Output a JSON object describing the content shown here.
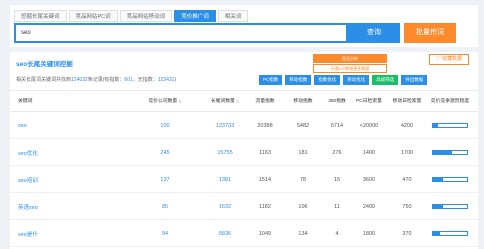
{
  "search": {
    "tabs": [
      "挖掘长尾关键词",
      "竞品网站PC词",
      "竞品网站移动词",
      "竞价推广词",
      "相关词"
    ],
    "active_tab": 3,
    "query": "seo",
    "search_button": "查询",
    "batch_button": "批量挖词"
  },
  "results": {
    "title": "seo长尾关键词挖掘",
    "compare_button": "竞品分析",
    "vip_button": "开通VIP解锁更多数据",
    "favorite_button": "♡ 收藏数据",
    "summary_prefix": "相关长尾词关键词共找到",
    "summary_total": "124032",
    "summary_mid": "条记录(有指数：",
    "summary_indexed": "601",
    "summary_suffix": "无指数：",
    "summary_no_index": "123431",
    "tools": [
      {
        "label": "PC指数",
        "color": "blue"
      },
      {
        "label": "移动指数",
        "color": "blue"
      },
      {
        "label": "指数优化",
        "color": "blue"
      },
      {
        "label": "移动优化",
        "color": "blue"
      },
      {
        "label": "高级筛选",
        "color": "green"
      },
      {
        "label": "导出数据",
        "color": "blue"
      }
    ],
    "columns": [
      "关键词",
      "竞价公司数量",
      "长尾词数量",
      "流量指数",
      "移动指数",
      "360指数",
      "PC日检索量",
      "移动日检索量",
      "竞价竞争激烈程度"
    ],
    "rows": [
      {
        "keyword": "seo",
        "companies": "100",
        "longtail": "123733",
        "flow": "20388",
        "mobile": "5482",
        "s360": "5714",
        "pc": "<20000",
        "mobile_daily": "4200",
        "competition": 0.15
      },
      {
        "keyword": "seo优化",
        "companies": "245",
        "longtail": "15755",
        "flow": "1163",
        "mobile": "181",
        "s360": "276",
        "pc": "1400",
        "mobile_daily": "1700",
        "competition": 0.55
      },
      {
        "keyword": "seo培训",
        "companies": "137",
        "longtail": "1381",
        "flow": "1514",
        "mobile": "78",
        "s360": "15",
        "pc": "3600",
        "mobile_daily": "470",
        "competition": 0.3
      },
      {
        "keyword": "英语seo",
        "companies": "85",
        "longtail": "1632",
        "flow": "1182",
        "mobile": "106",
        "s360": "11",
        "pc": "2400",
        "mobile_daily": "750",
        "competition": 0.3
      },
      {
        "keyword": "seo是什",
        "companies": "94",
        "longtail": "5836",
        "flow": "1049",
        "mobile": "134",
        "s360": "4",
        "pc": "1800",
        "mobile_daily": "370",
        "competition": 0.2
      }
    ]
  }
}
